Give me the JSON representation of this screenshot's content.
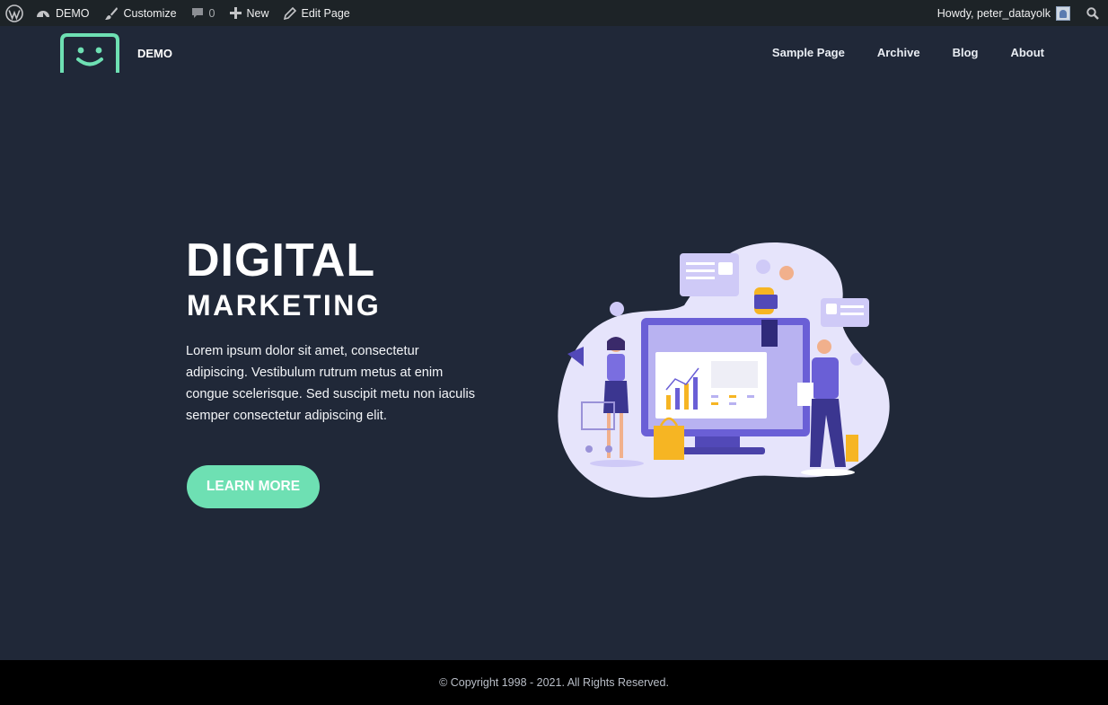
{
  "adminbar": {
    "site": "DEMO",
    "customize": "Customize",
    "comments_count": "0",
    "new": "New",
    "edit_page": "Edit Page",
    "howdy": "Howdy, peter_datayolk"
  },
  "header": {
    "site_name": "DEMO",
    "nav": [
      "Sample Page",
      "Archive",
      "Blog",
      "About"
    ]
  },
  "hero": {
    "title": "DIGITAL",
    "subtitle": "MARKETING",
    "body": "Lorem ipsum dolor sit amet, consectetur adipiscing. Vestibulum rutrum metus at enim congue scelerisque. Sed suscipit metu non iaculis semper consectetur adipiscing elit.",
    "cta": "LEARN MORE"
  },
  "footer": {
    "copyright": "© Copyright 1998 - 2021. All Rights Reserved."
  },
  "colors": {
    "background": "#202838",
    "accent": "#6ee0b3",
    "adminbar": "#1d2327",
    "footer": "#000000"
  }
}
